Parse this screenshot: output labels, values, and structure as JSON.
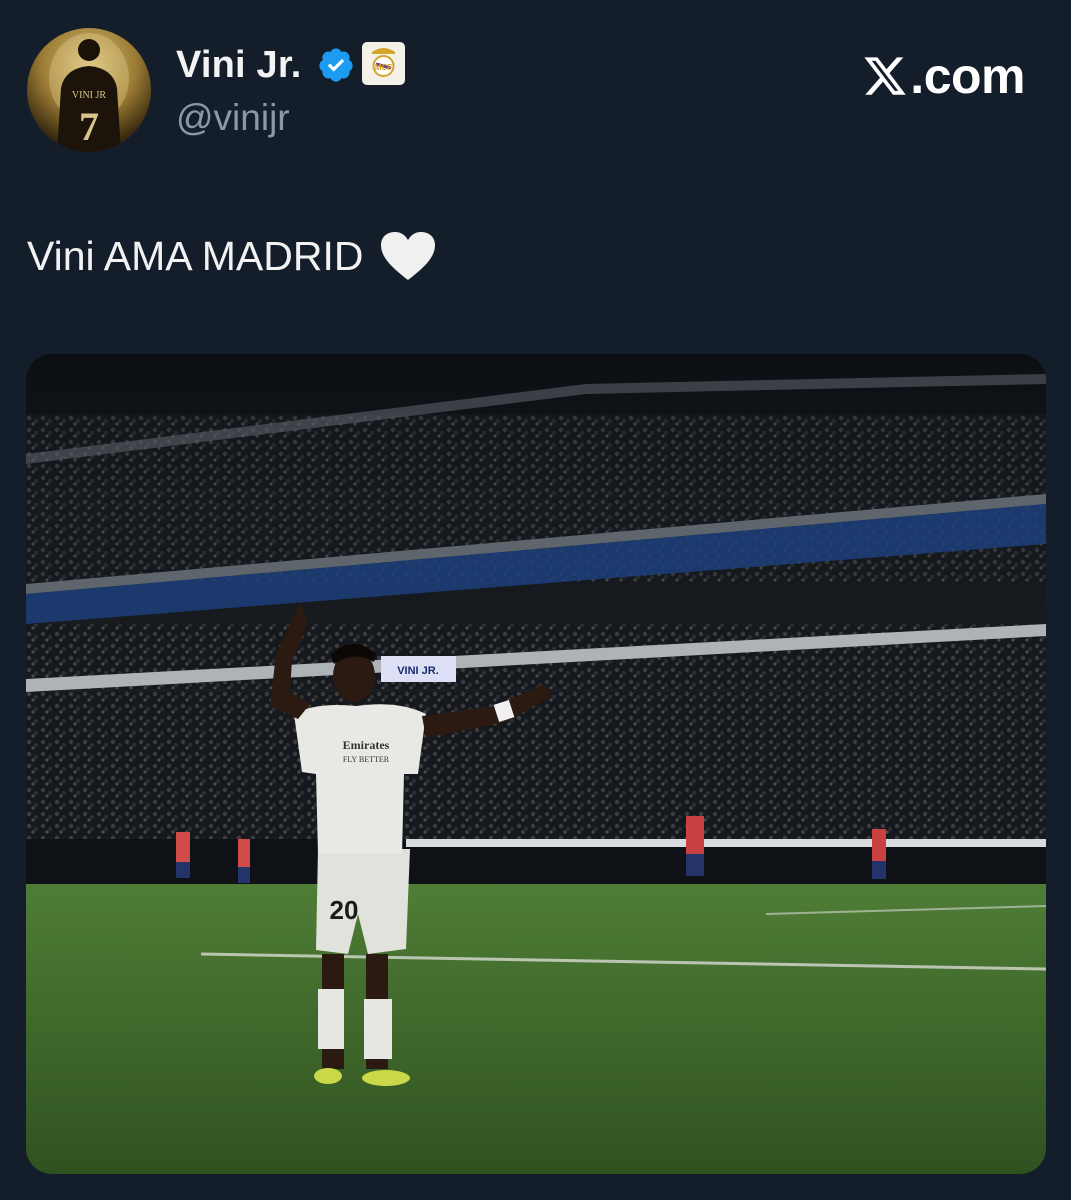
{
  "author": {
    "display_name": "Vini Jr.",
    "handle": "@vinijr",
    "verified_icon": "verified-check-icon",
    "affiliate_icon": "real-madrid-crest-icon",
    "avatar_text": "VINI JR",
    "avatar_number": "7"
  },
  "site": {
    "logo_icon": "x-logo-icon",
    "text": ".com"
  },
  "tweet": {
    "text": "Vini AMA MADRID",
    "emoji_icon": "white-heart-icon"
  },
  "media": {
    "banner_text": "VINI JR.",
    "sponsor": "Emirates",
    "sponsor_tagline": "FLY BETTER",
    "shirt_number": "20"
  },
  "colors": {
    "background": "#141d2a",
    "handle": "#8b98a5",
    "verified": "#1d9bf0",
    "pitch": "#3f6a2c"
  }
}
